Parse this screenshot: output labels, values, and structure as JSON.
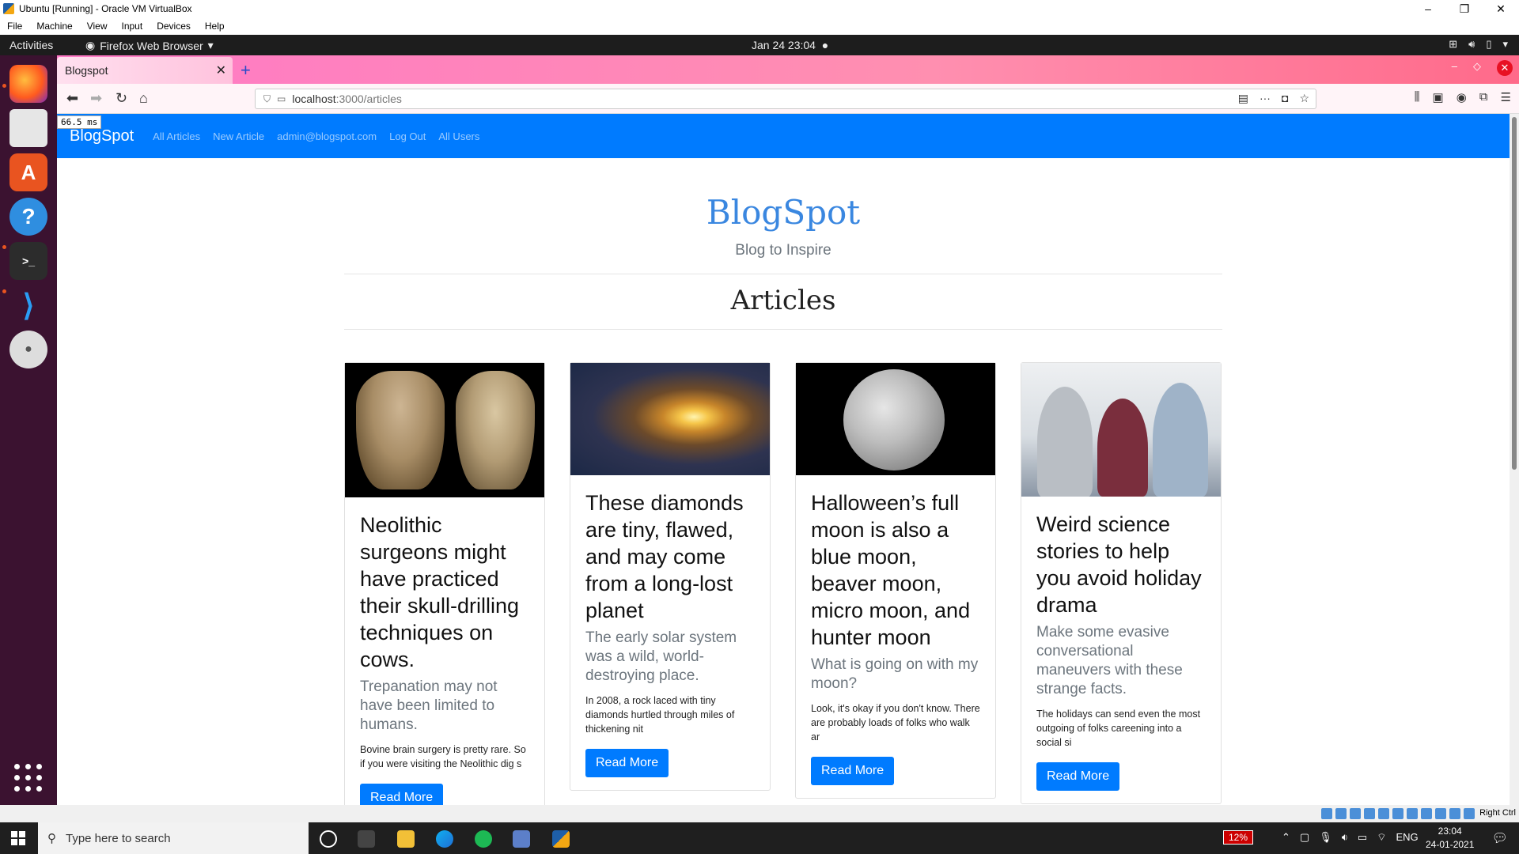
{
  "vbox": {
    "title": "Ubuntu [Running] - Oracle VM VirtualBox",
    "menu": [
      "File",
      "Machine",
      "View",
      "Input",
      "Devices",
      "Help"
    ],
    "host_key": "Right Ctrl"
  },
  "gnome": {
    "activities": "Activities",
    "app_name": "Firefox Web Browser",
    "clock": "Jan 24  23:04"
  },
  "dock": {
    "items": [
      "firefox-icon",
      "files-icon",
      "software-icon",
      "help-icon",
      "terminal-icon",
      "vscode-icon",
      "disc-icon"
    ],
    "apps_icon": "show-applications-icon"
  },
  "firefox": {
    "tab_title": "Blogspot",
    "url_host": "localhost",
    "url_path": ":3000/articles",
    "perf_badge": "66.5 ms"
  },
  "site": {
    "brand": "BlogSpot",
    "nav": [
      "All Articles",
      "New Article",
      "admin@blogspot.com",
      "Log Out",
      "All Users"
    ],
    "hero_title": "BlogSpot",
    "hero_subtitle": "Blog to Inspire",
    "articles_heading": "Articles",
    "cards": [
      {
        "title": "Neolithic surgeons might have practiced their skull-drilling techniques on cows.",
        "subtitle": "Trepanation may not have been limited to humans.",
        "excerpt": "Bovine brain surgery is pretty rare. So if you were visiting the Neolithic dig s",
        "button": "Read More",
        "image": "skull-image"
      },
      {
        "title": "These diamonds are tiny, flawed, and may come from a long-lost planet",
        "subtitle": "The early solar system was a wild, world-destroying place.",
        "excerpt": "In 2008, a rock laced with tiny diamonds hurtled through miles of thickening nit",
        "button": "Read More",
        "image": "galaxy-image"
      },
      {
        "title": "Halloween’s full moon is also a blue moon, beaver moon, micro moon, and hunter moon",
        "subtitle": "What is going on with my moon?",
        "excerpt": "Look, it's okay if you don't know. There are probably loads of folks who walk ar",
        "button": "Read More",
        "image": "moon-image"
      },
      {
        "title": "Weird science stories to help you avoid holiday drama",
        "subtitle": "Make some evasive conversational maneuvers with these strange facts.",
        "excerpt": "The holidays can send even the most outgoing of folks careening into a social si",
        "button": "Read More",
        "image": "people-image"
      }
    ]
  },
  "taskbar": {
    "search_placeholder": "Type here to search",
    "cpu": "12%",
    "lang": "ENG",
    "time": "23:04",
    "date": "24-01-2021"
  },
  "colors": {
    "navbar": "#007bff",
    "dock": "#3b1230",
    "hero_title": "#3a87e0"
  }
}
